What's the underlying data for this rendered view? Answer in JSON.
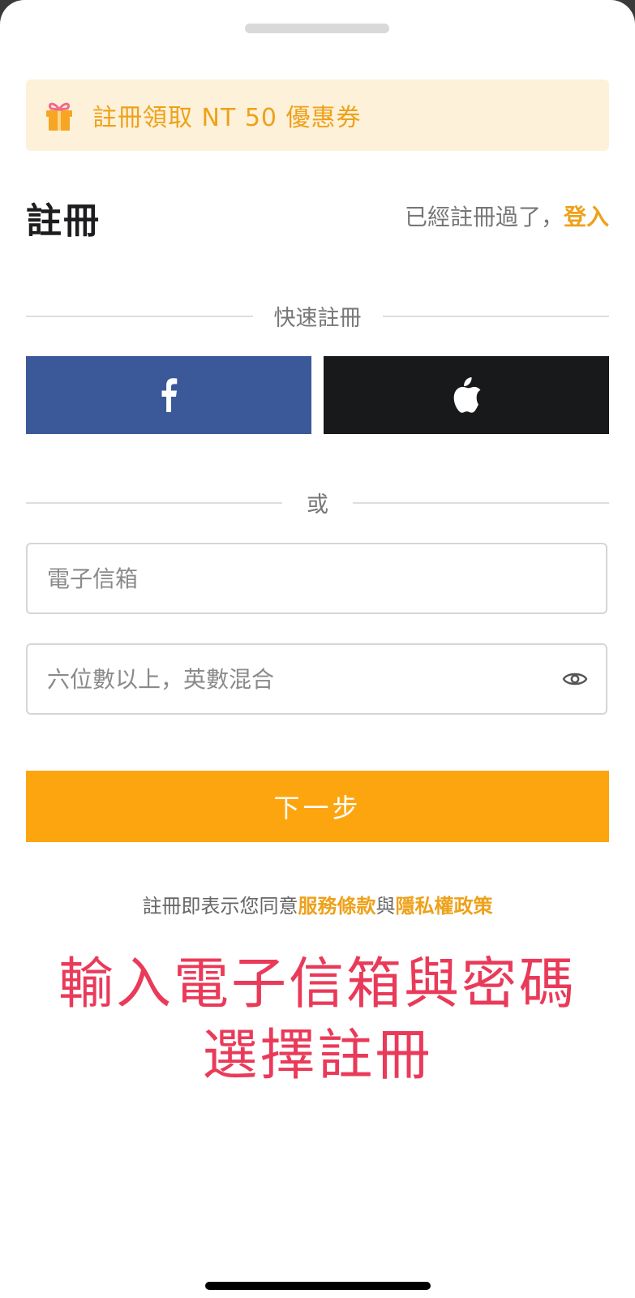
{
  "promo": {
    "text": "註冊領取 NT 50 優惠券",
    "icon": "gift-icon"
  },
  "header": {
    "title": "註冊",
    "login_prompt": "已經註冊過了，",
    "login_link": "登入"
  },
  "quick_signup": {
    "label": "快速註冊",
    "facebook_icon": "facebook-icon",
    "apple_icon": "apple-icon"
  },
  "or_label": "或",
  "form": {
    "email_placeholder": "電子信箱",
    "password_placeholder": "六位數以上，英數混合",
    "password_toggle_icon": "eye-icon",
    "next_label": "下一步"
  },
  "terms": {
    "prefix": "註冊即表示您同意",
    "service_link": "服務條款",
    "conjunction": "與",
    "privacy_link": "隱私權政策"
  },
  "annotation": {
    "line1": "輸入電子信箱與密碼",
    "line2": "選擇註冊"
  },
  "colors": {
    "accent": "#fda50f",
    "accent_text": "#eea11a",
    "facebook": "#3b5998",
    "apple": "#18191a",
    "annotation": "#ea3a59"
  }
}
